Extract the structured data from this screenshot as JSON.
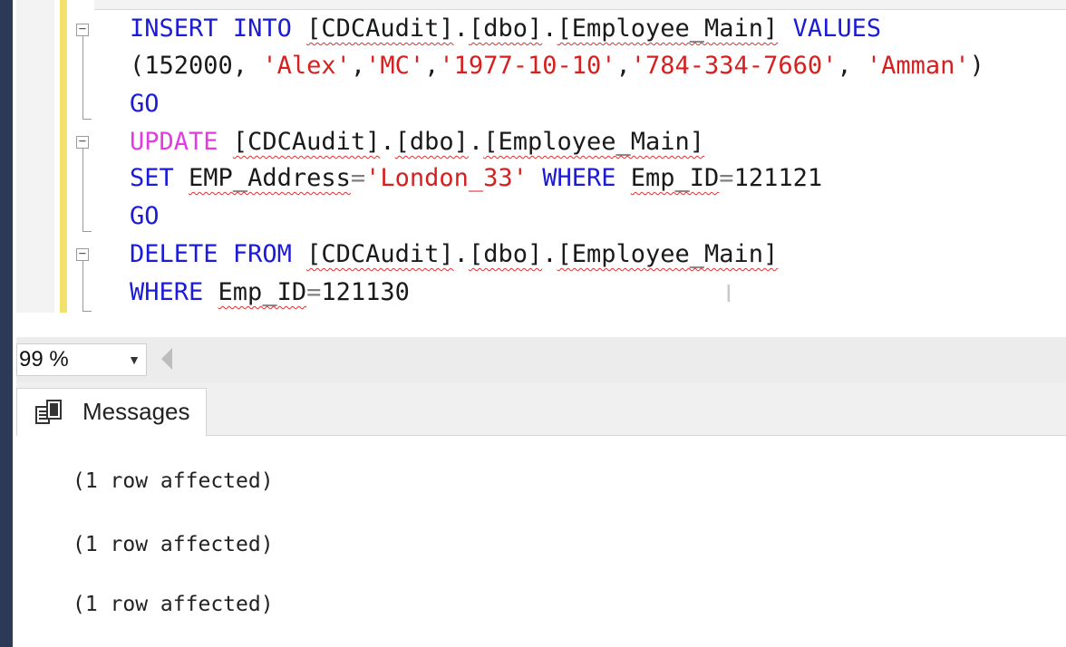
{
  "editor": {
    "lines": [
      {
        "tokens": [
          {
            "t": "INSERT",
            "c": "kw"
          },
          {
            "t": " "
          },
          {
            "t": "INTO",
            "c": "kw"
          },
          {
            "t": " "
          },
          {
            "t": "[CDCAudit]",
            "c": "sq"
          },
          {
            "t": "."
          },
          {
            "t": "[dbo]",
            "c": "sq"
          },
          {
            "t": "."
          },
          {
            "t": "[Employee_Main]",
            "c": "sq"
          },
          {
            "t": " "
          },
          {
            "t": "VALUES",
            "c": "kw"
          }
        ]
      },
      {
        "tokens": [
          {
            "t": "(152000, "
          },
          {
            "t": "'Alex'",
            "c": "str"
          },
          {
            "t": ","
          },
          {
            "t": "'MC'",
            "c": "str"
          },
          {
            "t": ","
          },
          {
            "t": "'1977-10-10'",
            "c": "str"
          },
          {
            "t": ","
          },
          {
            "t": "'784-334-7660'",
            "c": "str"
          },
          {
            "t": ", "
          },
          {
            "t": "'Amman'",
            "c": "str"
          },
          {
            "t": ")"
          }
        ]
      },
      {
        "tokens": [
          {
            "t": "GO",
            "c": "kw"
          }
        ]
      },
      {
        "tokens": [
          {
            "t": "UPDATE",
            "c": "kw2"
          },
          {
            "t": " "
          },
          {
            "t": "[CDCAudit]",
            "c": "sq"
          },
          {
            "t": "."
          },
          {
            "t": "[dbo]",
            "c": "sq"
          },
          {
            "t": "."
          },
          {
            "t": "[Employee_Main]",
            "c": "sq"
          }
        ]
      },
      {
        "tokens": [
          {
            "t": "SET",
            "c": "kw"
          },
          {
            "t": " "
          },
          {
            "t": "EMP_Address",
            "c": "sq"
          },
          {
            "t": "=",
            "c": "op"
          },
          {
            "t": "'London_33'",
            "c": "str"
          },
          {
            "t": " "
          },
          {
            "t": "WHERE",
            "c": "kw"
          },
          {
            "t": " "
          },
          {
            "t": "Emp_ID",
            "c": "sq"
          },
          {
            "t": "=",
            "c": "op"
          },
          {
            "t": "121121"
          }
        ]
      },
      {
        "tokens": [
          {
            "t": "GO",
            "c": "kw"
          }
        ]
      },
      {
        "tokens": [
          {
            "t": "DELETE",
            "c": "kw"
          },
          {
            "t": " "
          },
          {
            "t": "FROM",
            "c": "kw"
          },
          {
            "t": " "
          },
          {
            "t": "[CDCAudit]",
            "c": "sq"
          },
          {
            "t": "."
          },
          {
            "t": "[dbo]",
            "c": "sq"
          },
          {
            "t": "."
          },
          {
            "t": "[Employee_Main]",
            "c": "sq"
          }
        ]
      },
      {
        "tokens": [
          {
            "t": "WHERE",
            "c": "kw"
          },
          {
            "t": " "
          },
          {
            "t": "Emp_ID",
            "c": "sq"
          },
          {
            "t": "=",
            "c": "op"
          },
          {
            "t": "121130"
          }
        ]
      }
    ]
  },
  "zoom": {
    "value": "99 %"
  },
  "results": {
    "tab_label": "Messages",
    "messages": [
      "(1 row affected)",
      "(1 row affected)",
      "(1 row affected)"
    ]
  },
  "colors": {
    "keyword": "#1b1bd8",
    "keyword_dml": "#e23be2",
    "string": "#d62020",
    "change_bar": "#f2e26b"
  }
}
